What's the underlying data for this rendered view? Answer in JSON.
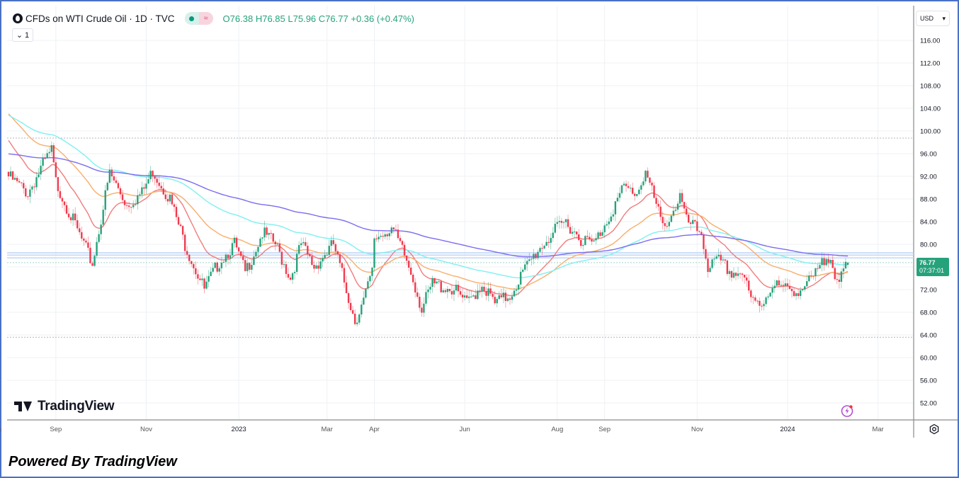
{
  "legend": {
    "symbol": "CFDs on WTI Crude Oil · 1D · TVC",
    "open_label": "O",
    "open": "76.38",
    "high_label": "H",
    "high": "76.85",
    "low_label": "L",
    "low": "75.96",
    "close_label": "C",
    "close": "76.77",
    "change": "+0.36 (+0.47%)",
    "collapse_count": "1"
  },
  "currency": "USD",
  "last_price": {
    "price": "76.77",
    "countdown": "07:37:01"
  },
  "brand": "TradingView",
  "footer": "Powered By TradingView",
  "colors": {
    "up": "#26a27b",
    "down": "#ef3b4e",
    "grid": "#eef1f5"
  },
  "chart_data": {
    "type": "candlestick",
    "title": "CFDs on WTI Crude Oil · 1D · TVC",
    "ylim": [
      50,
      118
    ],
    "yticks": [
      "116.00",
      "112.00",
      "108.00",
      "104.00",
      "100.00",
      "96.00",
      "92.00",
      "88.00",
      "84.00",
      "80.00",
      "76.00",
      "72.00",
      "68.00",
      "64.00",
      "60.00",
      "56.00",
      "52.00"
    ],
    "xticks": [
      {
        "label": "Aug",
        "bar": -4
      },
      {
        "label": "Sep",
        "bar": 22
      },
      {
        "label": "Nov",
        "bar": 64
      },
      {
        "label": "2023",
        "bar": 107
      },
      {
        "label": "Mar",
        "bar": 148
      },
      {
        "label": "Apr",
        "bar": 170
      },
      {
        "label": "Jun",
        "bar": 212
      },
      {
        "label": "Aug",
        "bar": 255
      },
      {
        "label": "Sep",
        "bar": 277
      },
      {
        "label": "Nov",
        "bar": 320
      },
      {
        "label": "2024",
        "bar": 362
      },
      {
        "label": "Mar",
        "bar": 404
      }
    ],
    "close_anchors": [
      [
        0,
        92
      ],
      [
        9,
        89
      ],
      [
        16,
        94
      ],
      [
        20,
        96.5
      ],
      [
        22,
        91
      ],
      [
        29,
        85
      ],
      [
        39,
        76.5
      ],
      [
        47,
        92.5
      ],
      [
        55,
        87
      ],
      [
        62,
        89
      ],
      [
        67,
        93
      ],
      [
        75,
        88
      ],
      [
        82,
        80
      ],
      [
        91,
        72
      ],
      [
        98,
        77
      ],
      [
        105,
        80
      ],
      [
        110,
        75
      ],
      [
        118,
        82
      ],
      [
        124,
        80
      ],
      [
        131,
        74
      ],
      [
        136,
        80
      ],
      [
        142,
        76
      ],
      [
        151,
        80
      ],
      [
        157,
        72
      ],
      [
        161,
        66.5
      ],
      [
        165,
        70
      ],
      [
        169,
        75
      ],
      [
        170,
        81
      ],
      [
        178,
        83
      ],
      [
        184,
        78
      ],
      [
        188,
        74
      ],
      [
        192,
        68.5
      ],
      [
        197,
        73
      ],
      [
        207,
        72
      ],
      [
        213,
        69.5
      ],
      [
        220,
        73
      ],
      [
        226,
        69.5
      ],
      [
        233,
        71
      ],
      [
        239,
        75
      ],
      [
        246,
        79
      ],
      [
        253,
        82
      ],
      [
        259,
        84
      ],
      [
        266,
        81
      ],
      [
        272,
        80
      ],
      [
        279,
        85
      ],
      [
        286,
        90
      ],
      [
        292,
        89
      ],
      [
        296,
        93
      ],
      [
        300,
        88
      ],
      [
        304,
        83
      ],
      [
        309,
        86
      ],
      [
        312,
        88.5
      ],
      [
        315,
        84
      ],
      [
        322,
        82
      ],
      [
        325,
        76
      ],
      [
        330,
        77
      ],
      [
        336,
        75
      ],
      [
        341,
        75
      ],
      [
        345,
        70
      ],
      [
        350,
        69.5
      ],
      [
        355,
        73
      ],
      [
        361,
        72
      ],
      [
        368,
        72
      ],
      [
        374,
        74
      ],
      [
        379,
        77
      ],
      [
        382,
        78.5
      ],
      [
        384,
        75
      ],
      [
        386,
        73
      ],
      [
        390,
        76.77
      ]
    ],
    "last_bar": {
      "open": 76.38,
      "high": 76.85,
      "low": 75.96,
      "close": 76.77
    },
    "moving_averages": [
      {
        "period": 20,
        "seed": 99,
        "color": "#f27c7c"
      },
      {
        "period": 50,
        "seed": 103.5,
        "color": "#f9ae6b"
      },
      {
        "period": 100,
        "seed": 103,
        "color": "#7ff0f0"
      },
      {
        "period": 200,
        "seed": 96,
        "color": "#7b6cf0"
      }
    ],
    "levels": [
      {
        "price": 78.5,
        "style": "solid",
        "color": "#bcd3f5"
      },
      {
        "price": 78.1,
        "style": "solid",
        "color": "#bcd3f5"
      },
      {
        "price": 77.6,
        "style": "solid",
        "color": "#bcd3f5"
      },
      {
        "price": 98.75,
        "style": "dotted",
        "color": "#b2b5be"
      },
      {
        "price": 63.6,
        "style": "dotted",
        "color": "#b2b5be"
      },
      {
        "price": 76.77,
        "style": "dotted",
        "color": "#9fd8c4"
      }
    ]
  }
}
